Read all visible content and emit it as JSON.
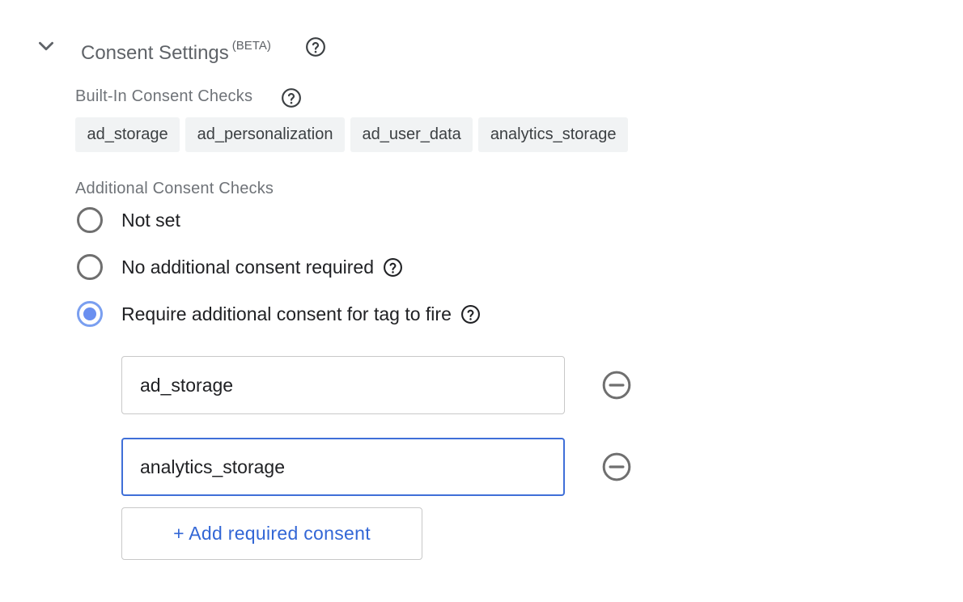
{
  "section": {
    "title": "Consent Settings",
    "badge": "(BETA)"
  },
  "builtin": {
    "label": "Built-In Consent Checks",
    "chips": [
      "ad_storage",
      "ad_personalization",
      "ad_user_data",
      "analytics_storage"
    ]
  },
  "additional": {
    "label": "Additional Consent Checks",
    "options": [
      {
        "label": "Not set",
        "selected": false
      },
      {
        "label": "No additional consent required",
        "selected": false
      },
      {
        "label": "Require additional consent for tag to fire",
        "selected": true
      }
    ],
    "required_consents": [
      "ad_storage",
      "analytics_storage"
    ],
    "add_button": "+ Add required consent"
  },
  "colors": {
    "accent": "#3367d6",
    "radio_selected": "#6a8ff0",
    "focus_border": "#3f6fd8"
  },
  "icons": {
    "expand": "chevron-down-icon",
    "help": "help-circle-icon",
    "remove": "remove-circle-icon"
  }
}
